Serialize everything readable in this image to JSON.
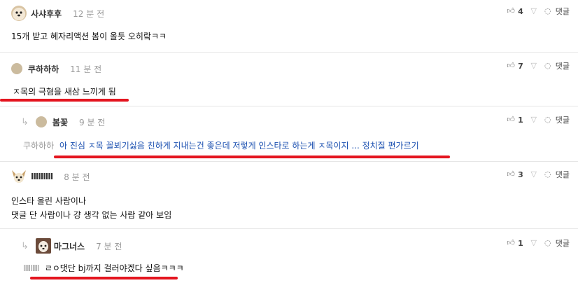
{
  "comments": [
    {
      "nick": "사샤후후",
      "time": "12 분 전",
      "lines": [
        "15개 받고 혜자리액션 봄이 올듯 오히랔ㅋㅋ"
      ],
      "likes": "4",
      "reply_label": "댓글"
    },
    {
      "nick": "쿠하하하",
      "time": "11 분 전",
      "lines": [
        "ㅈ목의 극혐을 새삼 느끼게 됨"
      ],
      "likes": "7",
      "reply_label": "댓글"
    },
    {
      "nick": "봄꽃",
      "time": "9 분 전",
      "mention": "쿠하하하",
      "lines": [
        "아 진심 ㅈ목 꼴뵈기싫음 친하게 지내는건 좋은데 저렇게 인스타로 하는게 ㅈ목이지 ... 정치질 편가르기"
      ],
      "likes": "1",
      "reply_label": "댓글"
    },
    {
      "nick": "IIIIIIIII",
      "time": "8 분 전",
      "lines": [
        "인스타 올린 사람이나",
        "댓글 단 사람이나 걍 생각 없는 사람 같아 보임"
      ],
      "likes": "3",
      "reply_label": "댓글"
    },
    {
      "nick": "마그너스",
      "time": "7 분 전",
      "mention": "IIIIIIIII",
      "lines": [
        "ㄹㅇ댓단 bj까지 걸러야겠다 싶음ㅋㅋㅋ"
      ],
      "likes": "1",
      "reply_label": "댓글"
    }
  ],
  "icons": {
    "like": "thumbs-up-icon",
    "dislike": "thumbs-down-icon",
    "reply": "speech-bubble-icon",
    "reply_arrow": "reply-arrow-icon"
  },
  "colors": {
    "highlight": "#e4151f",
    "link": "#1a4fb0"
  }
}
